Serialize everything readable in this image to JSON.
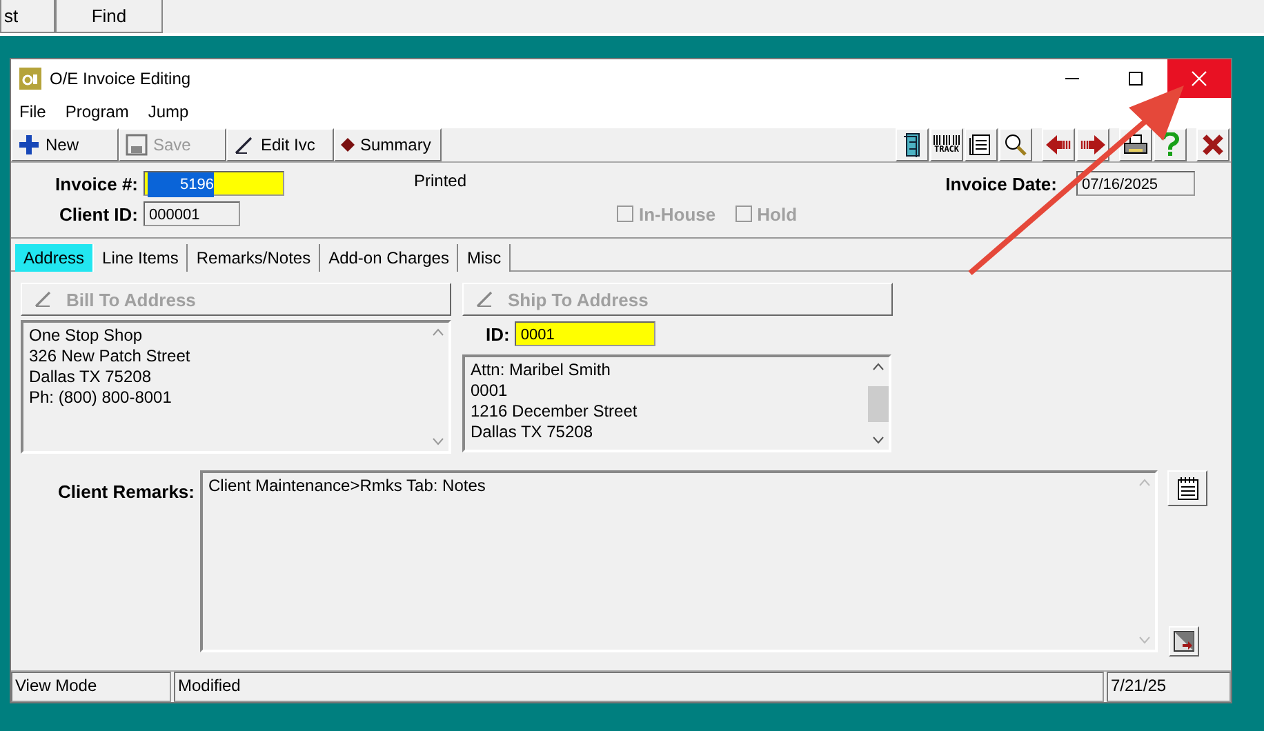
{
  "background_toolbar": {
    "buttons": [
      {
        "label": "st"
      },
      {
        "label": "Find"
      }
    ]
  },
  "window": {
    "title": "O/E Invoice Editing",
    "menu": [
      "File",
      "Program",
      "Jump"
    ],
    "toolbar": [
      {
        "label": "New",
        "kind": "plus",
        "disabled": false
      },
      {
        "label": "Save",
        "kind": "disk",
        "disabled": true
      },
      {
        "label": "Edit Ivc",
        "kind": "pen",
        "disabled": false
      },
      {
        "label": "Summary",
        "kind": "diamond",
        "disabled": false
      }
    ],
    "tool_icons": [
      {
        "kind": "cabinet"
      },
      {
        "kind": "track",
        "label": "TRACK"
      },
      {
        "kind": "document"
      },
      {
        "kind": "magnifier"
      },
      {
        "kind": "prev"
      },
      {
        "kind": "next"
      },
      {
        "kind": "printer"
      },
      {
        "kind": "help"
      },
      {
        "kind": "close"
      }
    ],
    "invoice_number": {
      "label": "Invoice #:",
      "value": "5196",
      "text_selected": true
    },
    "print_status": "Printed",
    "invoice_date": {
      "label": "Invoice Date:",
      "value": "07/16/2025"
    },
    "client_id": {
      "label": "Client ID:",
      "value": "000001"
    },
    "checkboxes": [
      {
        "label": "In-House",
        "checked": false,
        "disabled": true
      },
      {
        "label": "Hold",
        "checked": false,
        "disabled": true
      }
    ],
    "tabs": [
      {
        "label": "Address",
        "selected": true
      },
      {
        "label": "Line Items",
        "selected": false
      },
      {
        "label": "Remarks/Notes",
        "selected": false
      },
      {
        "label": "Add-on Charges",
        "selected": false
      },
      {
        "label": "Misc",
        "selected": false
      }
    ],
    "bill_to": {
      "button": "Bill To Address",
      "disabled": true,
      "lines": [
        "One Stop Shop",
        "326 New Patch Street",
        "Dallas  TX    75208",
        "Ph: (800) 800-8001"
      ]
    },
    "ship_to": {
      "button": "Ship To Address",
      "disabled": true,
      "id_label": "ID:",
      "id": "0001",
      "lines": [
        "Attn: Maribel Smith",
        "0001",
        "1216 December Street",
        "Dallas  TX    75208"
      ]
    },
    "client_remarks": {
      "label": "Client Remarks:",
      "text": "Client Maintenance>Rmks Tab: Notes"
    },
    "status_bar": [
      "View Mode",
      "Modified",
      "7/21/25"
    ]
  }
}
